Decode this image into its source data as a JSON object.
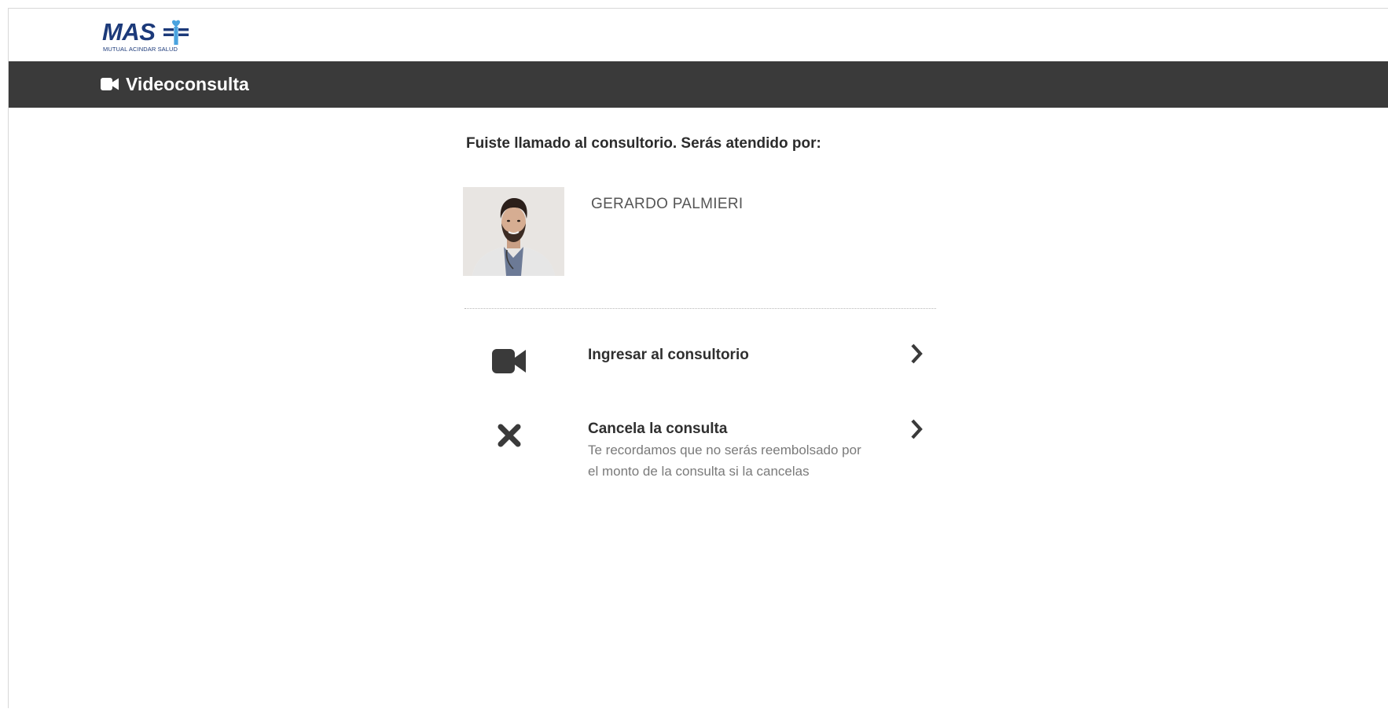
{
  "brand": {
    "logo_word": "MAS",
    "logo_subtitle": "MUTUAL ACINDAR SALUD",
    "colors": {
      "navy": "#1c3a7a",
      "light_blue": "#4aa3df"
    }
  },
  "nav": {
    "title": "Videoconsulta",
    "icon": "video-camera-icon",
    "background": "#3a3a3a"
  },
  "main": {
    "called_message": "Fuiste llamado al consultorio. Serás atendido por:",
    "doctor": {
      "name": "GERARDO PALMIERI"
    },
    "options": [
      {
        "title": "Ingresar al consultorio",
        "icon": "video-camera-icon",
        "chevron": "chevron-right-icon"
      },
      {
        "title": "Cancela la consulta",
        "description": "Te recordamos que no serás reembolsado por el monto de la consulta si la cancelas",
        "icon": "close-icon",
        "chevron": "chevron-right-icon"
      }
    ]
  }
}
